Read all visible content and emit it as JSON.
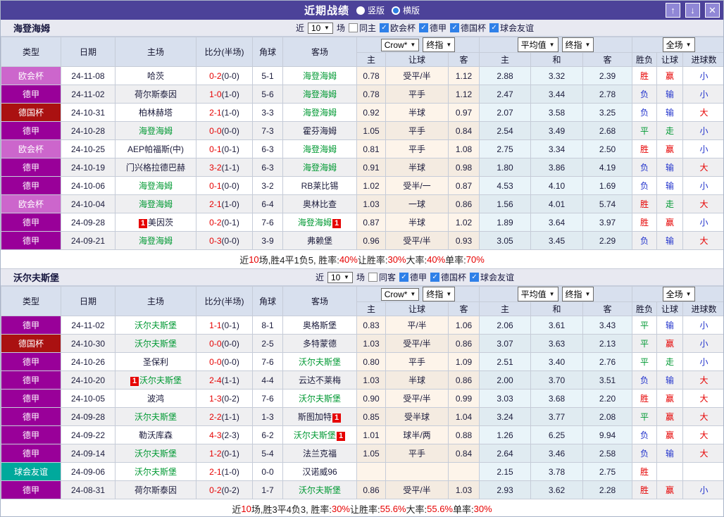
{
  "titlebar": {
    "title": "近期战绩",
    "radio_vertical": "竖版",
    "radio_horizontal": "横版",
    "icons": {
      "up": "↑",
      "down": "↓",
      "close": "✕"
    }
  },
  "table_header": {
    "type": "类型",
    "date": "日期",
    "home": "主场",
    "score": "比分(半场)",
    "corners": "角球",
    "away": "客场",
    "odds_selects": [
      "Crow*",
      "终指"
    ],
    "avg_selects": [
      "平均值",
      "终指"
    ],
    "scope_select": "全场",
    "sub": [
      "主",
      "让球",
      "客",
      "主",
      "和",
      "客",
      "胜负",
      "让球",
      "进球数"
    ]
  },
  "colors": {
    "accent_purple": "#4c4299",
    "team_green": "#009933",
    "score_red": "#e60000",
    "type_colors": {
      "欧会杯": "#cc66cc",
      "德甲": "#990099",
      "德国杯": "#aa1111",
      "球会友谊": "#00a99c"
    },
    "result_colors": {
      "胜": "#e60000",
      "平": "#009933",
      "负": "#2233cc",
      "赢": "#e60000",
      "走": "#009933",
      "输": "#2233cc",
      "大": "#e60000",
      "小": "#2233cc"
    }
  },
  "sections": [
    {
      "team": "海登海姆",
      "filter": {
        "prefix": "近",
        "count": "10",
        "suffix": "场",
        "same": "同主",
        "leagues": [
          "欧会杯",
          "德甲",
          "德国杯",
          "球会友谊"
        ]
      },
      "rows": [
        {
          "type": "欧会杯",
          "date": "24-11-08",
          "home": "哈茨",
          "home_focus": false,
          "home_badge": "",
          "score_ft": "0-2",
          "score_ht": "(0-0)",
          "corners": "5-1",
          "away": "海登海姆",
          "away_focus": true,
          "away_badge": "",
          "odds": [
            "0.78",
            "受平/半",
            "1.12"
          ],
          "avg": [
            "2.88",
            "3.32",
            "2.39"
          ],
          "result": "胜",
          "handicap": "赢",
          "goals": "小"
        },
        {
          "type": "德甲",
          "date": "24-11-02",
          "home": "荷尔斯泰因",
          "home_focus": false,
          "home_badge": "",
          "score_ft": "1-0",
          "score_ht": "(1-0)",
          "corners": "5-6",
          "away": "海登海姆",
          "away_focus": true,
          "away_badge": "",
          "odds": [
            "0.78",
            "平手",
            "1.12"
          ],
          "avg": [
            "2.47",
            "3.44",
            "2.78"
          ],
          "result": "负",
          "handicap": "输",
          "goals": "小"
        },
        {
          "type": "德国杯",
          "date": "24-10-31",
          "home": "柏林赫塔",
          "home_focus": false,
          "home_badge": "",
          "score_ft": "2-1",
          "score_ht": "(1-0)",
          "corners": "3-3",
          "away": "海登海姆",
          "away_focus": true,
          "away_badge": "",
          "odds": [
            "0.92",
            "半球",
            "0.97"
          ],
          "avg": [
            "2.07",
            "3.58",
            "3.25"
          ],
          "result": "负",
          "handicap": "输",
          "goals": "大"
        },
        {
          "type": "德甲",
          "date": "24-10-28",
          "home": "海登海姆",
          "home_focus": true,
          "home_badge": "",
          "score_ft": "0-0",
          "score_ht": "(0-0)",
          "corners": "7-3",
          "away": "霍芬海姆",
          "away_focus": false,
          "away_badge": "",
          "odds": [
            "1.05",
            "平手",
            "0.84"
          ],
          "avg": [
            "2.54",
            "3.49",
            "2.68"
          ],
          "result": "平",
          "handicap": "走",
          "goals": "小"
        },
        {
          "type": "欧会杯",
          "date": "24-10-25",
          "home": "AEP帕福斯(中)",
          "home_focus": false,
          "home_badge": "",
          "score_ft": "0-1",
          "score_ht": "(0-1)",
          "corners": "6-3",
          "away": "海登海姆",
          "away_focus": true,
          "away_badge": "",
          "odds": [
            "0.81",
            "平手",
            "1.08"
          ],
          "avg": [
            "2.75",
            "3.34",
            "2.50"
          ],
          "result": "胜",
          "handicap": "赢",
          "goals": "小"
        },
        {
          "type": "德甲",
          "date": "24-10-19",
          "home": "门兴格拉德巴赫",
          "home_focus": false,
          "home_badge": "",
          "score_ft": "3-2",
          "score_ht": "(1-1)",
          "corners": "6-3",
          "away": "海登海姆",
          "away_focus": true,
          "away_badge": "",
          "odds": [
            "0.91",
            "半球",
            "0.98"
          ],
          "avg": [
            "1.80",
            "3.86",
            "4.19"
          ],
          "result": "负",
          "handicap": "输",
          "goals": "大"
        },
        {
          "type": "德甲",
          "date": "24-10-06",
          "home": "海登海姆",
          "home_focus": true,
          "home_badge": "",
          "score_ft": "0-1",
          "score_ht": "(0-0)",
          "corners": "3-2",
          "away": "RB莱比锡",
          "away_focus": false,
          "away_badge": "",
          "odds": [
            "1.02",
            "受半/一",
            "0.87"
          ],
          "avg": [
            "4.53",
            "4.10",
            "1.69"
          ],
          "result": "负",
          "handicap": "输",
          "goals": "小"
        },
        {
          "type": "欧会杯",
          "date": "24-10-04",
          "home": "海登海姆",
          "home_focus": true,
          "home_badge": "",
          "score_ft": "2-1",
          "score_ht": "(1-0)",
          "corners": "6-4",
          "away": "奥林比查",
          "away_focus": false,
          "away_badge": "",
          "odds": [
            "1.03",
            "一球",
            "0.86"
          ],
          "avg": [
            "1.56",
            "4.01",
            "5.74"
          ],
          "result": "胜",
          "handicap": "走",
          "goals": "大"
        },
        {
          "type": "德甲",
          "date": "24-09-28",
          "home": "美因茨",
          "home_focus": false,
          "home_badge": "1",
          "score_ft": "0-2",
          "score_ht": "(0-1)",
          "corners": "7-6",
          "away": "海登海姆",
          "away_focus": true,
          "away_badge": "1",
          "odds": [
            "0.87",
            "半球",
            "1.02"
          ],
          "avg": [
            "1.89",
            "3.64",
            "3.97"
          ],
          "result": "胜",
          "handicap": "赢",
          "goals": "小"
        },
        {
          "type": "德甲",
          "date": "24-09-21",
          "home": "海登海姆",
          "home_focus": true,
          "home_badge": "",
          "score_ft": "0-3",
          "score_ht": "(0-0)",
          "corners": "3-9",
          "away": "弗赖堡",
          "away_focus": false,
          "away_badge": "",
          "odds": [
            "0.96",
            "受平/半",
            "0.93"
          ],
          "avg": [
            "3.05",
            "3.45",
            "2.29"
          ],
          "result": "负",
          "handicap": "输",
          "goals": "大"
        }
      ],
      "footer": [
        "近",
        "10",
        "场,胜4平1负5, 胜率:",
        "40%",
        " 让胜率:",
        "30%",
        " 大率:",
        "40%",
        " 单率:",
        "70%"
      ]
    },
    {
      "team": "沃尔夫斯堡",
      "filter": {
        "prefix": "近",
        "count": "10",
        "suffix": "场",
        "same": "同客",
        "leagues": [
          "德甲",
          "德国杯",
          "球会友谊"
        ]
      },
      "rows": [
        {
          "type": "德甲",
          "date": "24-11-02",
          "home": "沃尔夫斯堡",
          "home_focus": true,
          "home_badge": "",
          "score_ft": "1-1",
          "score_ht": "(0-1)",
          "corners": "8-1",
          "away": "奥格斯堡",
          "away_focus": false,
          "away_badge": "",
          "odds": [
            "0.83",
            "平/半",
            "1.06"
          ],
          "avg": [
            "2.06",
            "3.61",
            "3.43"
          ],
          "result": "平",
          "handicap": "输",
          "goals": "小"
        },
        {
          "type": "德国杯",
          "date": "24-10-30",
          "home": "沃尔夫斯堡",
          "home_focus": true,
          "home_badge": "",
          "score_ft": "0-0",
          "score_ht": "(0-0)",
          "corners": "2-5",
          "away": "多特蒙德",
          "away_focus": false,
          "away_badge": "",
          "odds": [
            "1.03",
            "受平/半",
            "0.86"
          ],
          "avg": [
            "3.07",
            "3.63",
            "2.13"
          ],
          "result": "平",
          "handicap": "赢",
          "goals": "小"
        },
        {
          "type": "德甲",
          "date": "24-10-26",
          "home": "圣保利",
          "home_focus": false,
          "home_badge": "",
          "score_ft": "0-0",
          "score_ht": "(0-0)",
          "corners": "7-6",
          "away": "沃尔夫斯堡",
          "away_focus": true,
          "away_badge": "",
          "odds": [
            "0.80",
            "平手",
            "1.09"
          ],
          "avg": [
            "2.51",
            "3.40",
            "2.76"
          ],
          "result": "平",
          "handicap": "走",
          "goals": "小"
        },
        {
          "type": "德甲",
          "date": "24-10-20",
          "home": "沃尔夫斯堡",
          "home_focus": true,
          "home_badge": "1",
          "score_ft": "2-4",
          "score_ht": "(1-1)",
          "corners": "4-4",
          "away": "云达不莱梅",
          "away_focus": false,
          "away_badge": "",
          "odds": [
            "1.03",
            "半球",
            "0.86"
          ],
          "avg": [
            "2.00",
            "3.70",
            "3.51"
          ],
          "result": "负",
          "handicap": "输",
          "goals": "大"
        },
        {
          "type": "德甲",
          "date": "24-10-05",
          "home": "波鸿",
          "home_focus": false,
          "home_badge": "",
          "score_ft": "1-3",
          "score_ht": "(0-2)",
          "corners": "7-6",
          "away": "沃尔夫斯堡",
          "away_focus": true,
          "away_badge": "",
          "odds": [
            "0.90",
            "受平/半",
            "0.99"
          ],
          "avg": [
            "3.03",
            "3.68",
            "2.20"
          ],
          "result": "胜",
          "handicap": "赢",
          "goals": "大"
        },
        {
          "type": "德甲",
          "date": "24-09-28",
          "home": "沃尔夫斯堡",
          "home_focus": true,
          "home_badge": "",
          "score_ft": "2-2",
          "score_ht": "(1-1)",
          "corners": "1-3",
          "away": "斯图加特",
          "away_focus": false,
          "away_badge": "1",
          "odds": [
            "0.85",
            "受半球",
            "1.04"
          ],
          "avg": [
            "3.24",
            "3.77",
            "2.08"
          ],
          "result": "平",
          "handicap": "赢",
          "goals": "大"
        },
        {
          "type": "德甲",
          "date": "24-09-22",
          "home": "勒沃库森",
          "home_focus": false,
          "home_badge": "",
          "score_ft": "4-3",
          "score_ht": "(2-3)",
          "corners": "6-2",
          "away": "沃尔夫斯堡",
          "away_focus": true,
          "away_badge": "1",
          "odds": [
            "1.01",
            "球半/两",
            "0.88"
          ],
          "avg": [
            "1.26",
            "6.25",
            "9.94"
          ],
          "result": "负",
          "handicap": "赢",
          "goals": "大"
        },
        {
          "type": "德甲",
          "date": "24-09-14",
          "home": "沃尔夫斯堡",
          "home_focus": true,
          "home_badge": "",
          "score_ft": "1-2",
          "score_ht": "(0-1)",
          "corners": "5-4",
          "away": "法兰克福",
          "away_focus": false,
          "away_badge": "",
          "odds": [
            "1.05",
            "平手",
            "0.84"
          ],
          "avg": [
            "2.64",
            "3.46",
            "2.58"
          ],
          "result": "负",
          "handicap": "输",
          "goals": "大"
        },
        {
          "type": "球会友谊",
          "date": "24-09-06",
          "home": "沃尔夫斯堡",
          "home_focus": true,
          "home_badge": "",
          "score_ft": "2-1",
          "score_ht": "(1-0)",
          "corners": "0-0",
          "away": "汉诺威96",
          "away_focus": false,
          "away_badge": "",
          "odds": [
            "",
            "",
            ""
          ],
          "avg": [
            "2.15",
            "3.78",
            "2.75"
          ],
          "result": "胜",
          "handicap": "",
          "goals": ""
        },
        {
          "type": "德甲",
          "date": "24-08-31",
          "home": "荷尔斯泰因",
          "home_focus": false,
          "home_badge": "",
          "score_ft": "0-2",
          "score_ht": "(0-2)",
          "corners": "1-7",
          "away": "沃尔夫斯堡",
          "away_focus": true,
          "away_badge": "",
          "odds": [
            "0.86",
            "受平/半",
            "1.03"
          ],
          "avg": [
            "2.93",
            "3.62",
            "2.28"
          ],
          "result": "胜",
          "handicap": "赢",
          "goals": "小"
        }
      ],
      "footer": [
        "近",
        "10",
        "场,胜3平4负3, 胜率:",
        "30%",
        " 让胜率:",
        "55.6%",
        " 大率:",
        "55.6%",
        " 单率:",
        "30%"
      ]
    }
  ]
}
